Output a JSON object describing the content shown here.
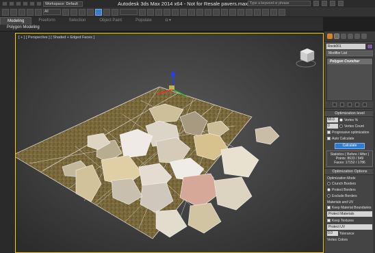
{
  "titlebar": {
    "workspace": "Workspace: Default",
    "title": "Autodesk 3ds Max  2014 x64  -  Not for Resale    pavers.max",
    "search_placeholder": "Type a keyword or phrase"
  },
  "toolbar": {
    "selection_filter": "All"
  },
  "ribbon": {
    "tabs": [
      "Modeling",
      "Freeform",
      "Selection",
      "Object Paint",
      "Populate"
    ],
    "active_tab": "Modeling",
    "sub_label": "Polygon Modeling"
  },
  "viewport": {
    "label": "[ + ] [ Perspective ] [ Shaded + Edged Faces ]"
  },
  "command_panel": {
    "object_name": "Rock001",
    "object_color": "#7a5a9c",
    "modifier_list": "Modifier List",
    "stack_item": "Polygon Cruncher",
    "optimization_level": {
      "title": "Optimization level",
      "vertex_pct_value": "60.0",
      "vertex_pct_label": "Vertex %",
      "vertex_count_value": "0",
      "vertex_count_label": "Vertex Count",
      "progressive": "Progressive optimization",
      "auto_calc": "Auto Calculate",
      "calc_button": "Calculate",
      "stats_title": "Statistics ( Before / After )",
      "stats_points": "Points: 8633 / 949",
      "stats_faces": "Faces: 17152 / 1786"
    },
    "optimization_options": {
      "title": "Optimization Options",
      "mode_label": "Optimization Mode",
      "modes": [
        "Crunch Borders",
        "Protect Borders",
        "Exclude Borders"
      ],
      "selected_mode": "Protect Borders",
      "materials_label": "Materials and UV",
      "keep_boundaries": "Keep Material Boundaries",
      "protect_materials": "Protect Materials",
      "keep_textures": "Keep Textures",
      "protect_uv": "Protect UV",
      "tolerance_value": "0.0",
      "tolerance_label": "Tolerance",
      "vertex_colors": "Vertex Colors"
    }
  }
}
